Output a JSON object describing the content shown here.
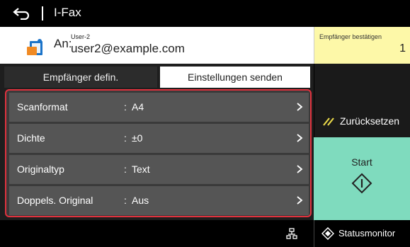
{
  "app": {
    "title": "I-Fax"
  },
  "recipient": {
    "to_label": "An:",
    "user_name": "User-2",
    "email": "user2@example.com",
    "confirm_label": "Empfänger bestätigen",
    "confirm_count": "1"
  },
  "tabs": [
    {
      "label": "Empfänger defin.",
      "active": false
    },
    {
      "label": "Einstellungen senden",
      "active": true
    }
  ],
  "settings": [
    {
      "label": "Scanformat",
      "colon": ":",
      "value": "A4"
    },
    {
      "label": "Dichte",
      "colon": ":",
      "value": "±0"
    },
    {
      "label": "Originaltyp",
      "colon": ":",
      "value": "Text"
    },
    {
      "label": "Doppels. Original",
      "colon": ":",
      "value": "Aus"
    }
  ],
  "actions": {
    "reset_label": "Zurücksetzen",
    "start_label": "Start"
  },
  "bottombar": {
    "status_label": "Statusmonitor"
  },
  "colors": {
    "highlight_border": "#e0323e",
    "start": "#7fdbbe",
    "confirm_bg": "#fdf8a8",
    "reset_icon": "#e8d84a"
  },
  "icons": {
    "back": "back-arrow-icon",
    "address_book": "address-book-icon",
    "chevron": "chevron-right-icon",
    "reset": "reset-slash-icon",
    "start": "start-diamond-icon",
    "network": "network-icon",
    "status": "status-monitor-icon"
  }
}
